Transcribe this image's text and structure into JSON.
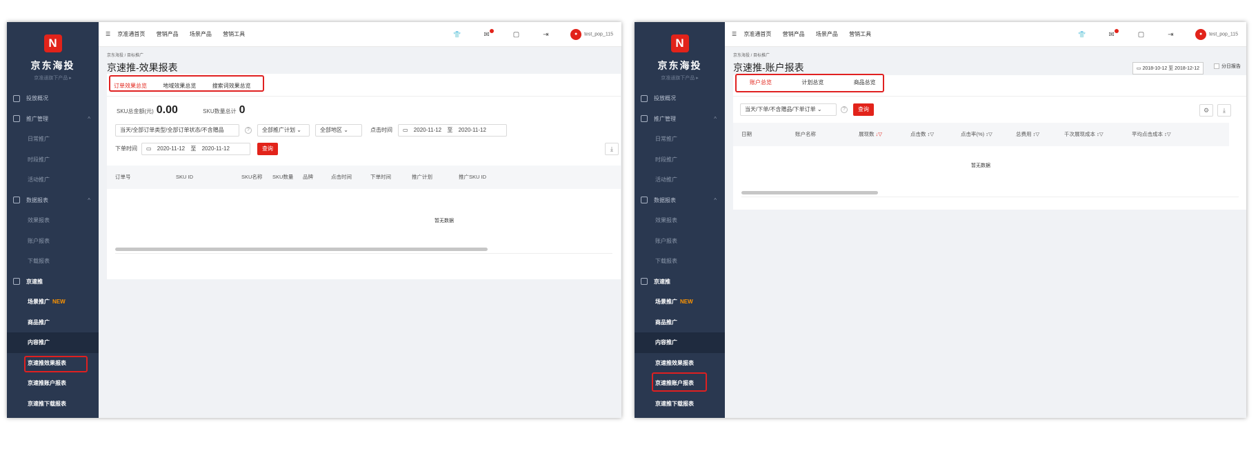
{
  "left": {
    "brand": "京东海投",
    "brand_sub": "京准通旗下产品 ▸",
    "menu": [
      {
        "label": "投放概况",
        "type": "group"
      },
      {
        "label": "推广管理",
        "type": "group",
        "caret": "^"
      },
      {
        "label": "日常推广",
        "type": "item"
      },
      {
        "label": "时段推广",
        "type": "item"
      },
      {
        "label": "活动推广",
        "type": "item"
      },
      {
        "label": "数据报表",
        "type": "group",
        "caret": "^"
      },
      {
        "label": "效果报表",
        "type": "item"
      },
      {
        "label": "账户报表",
        "type": "item"
      },
      {
        "label": "下载报表",
        "type": "item"
      },
      {
        "label": "京速推",
        "type": "group"
      },
      {
        "label": "场景推广",
        "type": "bright",
        "badge": "NEW"
      },
      {
        "label": "商品推广",
        "type": "bright"
      },
      {
        "label": "内容推广",
        "type": "bright"
      },
      {
        "label": "京速推效果报表",
        "type": "bright"
      },
      {
        "label": "京速推账户报表",
        "type": "bright"
      },
      {
        "label": "京速推下载报表",
        "type": "bright"
      }
    ],
    "nav": [
      "京准通首页",
      "营销产品",
      "场景产品",
      "营销工具"
    ],
    "user": "test_pop_115",
    "breadcrumb": "京东海投 / 目标推广",
    "title": "京速推-效果报表",
    "tabs": [
      "订单效果总览",
      "地域效果总览",
      "搜索词效果总览"
    ],
    "stats": {
      "amount_label": "SKU总金额(元)",
      "amount_value": "0.00",
      "qty_label": "SKU数量总计",
      "qty_value": "0"
    },
    "filters": {
      "order_type": "当天/全部订单类型/全部订单状态/不含赠品",
      "plan": "全部推广计划",
      "region": "全部地区",
      "click_time_label": "点击时间",
      "click_start": "2020-11-12",
      "click_to": "至",
      "click_end": "2020-11-12",
      "order_time_label": "下单时间",
      "order_start": "2020-11-12",
      "order_to": "至",
      "order_end": "2020-11-12",
      "query": "查询"
    },
    "columns": [
      "订单号",
      "SKU ID",
      "SKU名称",
      "SKU数量",
      "品牌",
      "点击时间",
      "下单时间",
      "推广计划",
      "推广SKU ID"
    ],
    "empty": "暂无数据"
  },
  "right": {
    "brand": "京东海投",
    "brand_sub": "京准通旗下产品 ▸",
    "menu": [
      {
        "label": "投放概况",
        "type": "group"
      },
      {
        "label": "推广管理",
        "type": "group",
        "caret": "^"
      },
      {
        "label": "日常推广",
        "type": "item"
      },
      {
        "label": "时段推广",
        "type": "item"
      },
      {
        "label": "活动推广",
        "type": "item"
      },
      {
        "label": "数据报表",
        "type": "group",
        "caret": "^"
      },
      {
        "label": "效果报表",
        "type": "item"
      },
      {
        "label": "账户报表",
        "type": "item"
      },
      {
        "label": "下载报表",
        "type": "item"
      },
      {
        "label": "京速推",
        "type": "group"
      },
      {
        "label": "场景推广",
        "type": "bright",
        "badge": "NEW"
      },
      {
        "label": "商品推广",
        "type": "bright"
      },
      {
        "label": "内容推广",
        "type": "bright"
      },
      {
        "label": "京速推效果报表",
        "type": "bright"
      },
      {
        "label": "京速推账户报表",
        "type": "bright"
      },
      {
        "label": "京速推下载报表",
        "type": "bright"
      }
    ],
    "nav": [
      "京准通首页",
      "营销产品",
      "场景产品",
      "营销工具"
    ],
    "user": "test_pop_115",
    "breadcrumb": "京东海投 / 目标推广",
    "title": "京速推-账户报表",
    "date_range": "2018-10-12 至 2018-12-12",
    "split_report": "分日报告",
    "tabs": [
      "账户总览",
      "计划总览",
      "商品总览"
    ],
    "filter": "当天/下单/不含赠品/下单订单",
    "query": "查询",
    "columns": [
      "日期",
      "账户名称",
      "展现数",
      "点击数",
      "点击率(%)",
      "总费用",
      "千次展现成本",
      "平均点击成本"
    ],
    "empty": "暂无数据"
  },
  "icons": {
    "menu": "☰",
    "shirt": "👕",
    "mail": "✉",
    "doc": "▢",
    "exit": "⇥",
    "download": "⤓",
    "settings": "⚙",
    "calendar": "📅"
  }
}
